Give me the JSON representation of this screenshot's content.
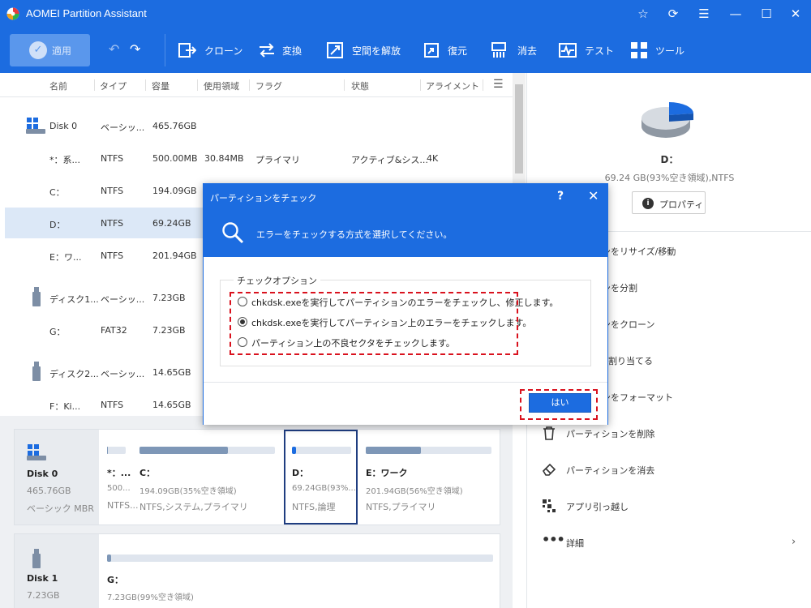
{
  "app": {
    "title": "AOMEI Partition Assistant"
  },
  "toolbar": {
    "apply": "適用",
    "tools": [
      {
        "label": "クローン",
        "icon": "clone-icon"
      },
      {
        "label": "変換",
        "icon": "convert-icon"
      },
      {
        "label": "空間を解放",
        "icon": "free-space-icon"
      },
      {
        "label": "復元",
        "icon": "recover-icon"
      },
      {
        "label": "消去",
        "icon": "wipe-icon"
      },
      {
        "label": "テスト",
        "icon": "test-icon"
      },
      {
        "label": "ツール",
        "icon": "tools-icon"
      }
    ]
  },
  "grid": {
    "columns": [
      "名前",
      "タイプ",
      "容量",
      "使用領域",
      "フラグ",
      "状態",
      "アライメント"
    ],
    "rows": [
      {
        "name": "Disk 0",
        "type": "ベーシッ...",
        "capacity": "465.76GB",
        "used": "",
        "flag": "",
        "status": "",
        "align": ""
      },
      {
        "name": "*：系...",
        "type": "NTFS",
        "capacity": "500.00MB",
        "used": "30.84MB",
        "flag": "プライマリ",
        "status": "アクティブ&シス...",
        "align": "4K"
      },
      {
        "name": "C：",
        "type": "NTFS",
        "capacity": "194.09GB",
        "used": "",
        "flag": "",
        "status": "",
        "align": ""
      },
      {
        "name": "D：",
        "type": "NTFS",
        "capacity": "69.24GB",
        "used": "",
        "flag": "",
        "status": "",
        "align": ""
      },
      {
        "name": "E：ワ...",
        "type": "NTFS",
        "capacity": "201.94GB",
        "used": "",
        "flag": "",
        "status": "",
        "align": ""
      },
      {
        "name": "ディスク1...",
        "type": "ベーシッ...",
        "capacity": "7.23GB",
        "used": "",
        "flag": "",
        "status": "",
        "align": ""
      },
      {
        "name": "G：",
        "type": "FAT32",
        "capacity": "7.23GB",
        "used": "",
        "flag": "",
        "status": "",
        "align": ""
      },
      {
        "name": "ディスク2...",
        "type": "ベーシッ...",
        "capacity": "14.65GB",
        "used": "",
        "flag": "",
        "status": "",
        "align": ""
      },
      {
        "name": "F：Ki...",
        "type": "NTFS",
        "capacity": "14.65GB",
        "used": "",
        "flag": "",
        "status": "",
        "align": ""
      }
    ]
  },
  "diskmap": {
    "disk0": {
      "name": "Disk 0",
      "size": "465.76GB",
      "type": "ベーシック MBR",
      "partitions": [
        {
          "name": "*：...",
          "size": "500...",
          "fs": "NTFS...",
          "used_fraction": 0.06
        },
        {
          "name": "C：",
          "size": "194.09GB(35%空き領域)",
          "fs": "NTFS,システム,プライマリ",
          "used_fraction": 0.65
        },
        {
          "name": "D：",
          "size": "69.24GB(93%...",
          "fs": "NTFS,論理",
          "used_fraction": 0.07
        },
        {
          "name": "E：ワーク",
          "size": "201.94GB(56%空き領域)",
          "fs": "NTFS,プライマリ",
          "used_fraction": 0.44
        }
      ]
    },
    "disk1": {
      "name": "Disk 1",
      "size": "7.23GB",
      "partition": {
        "name": "G：",
        "size": "7.23GB(99%空き領域)",
        "used_fraction": 0.01
      }
    }
  },
  "right": {
    "drive": "D：",
    "info": "69.24 GB(93%空き領域),NTFS",
    "properties": "プロパティ",
    "pie_free_fraction": 0.93,
    "ops": [
      {
        "label": "ンをリサイズ/移動",
        "icon": "resize-icon"
      },
      {
        "label": "ンを分割",
        "icon": "split-icon"
      },
      {
        "label": "ンをクローン",
        "icon": "clone-partition-icon"
      },
      {
        "label": "割り当てる",
        "icon": "allocate-icon"
      },
      {
        "label": "ンをフォーマット",
        "icon": "format-icon"
      },
      {
        "label": "パーティションを削除",
        "icon": "trash-icon"
      },
      {
        "label": "パーティションを消去",
        "icon": "eraser-icon"
      },
      {
        "label": "アプリ引っ越し",
        "icon": "app-move-icon"
      },
      {
        "label": "詳細",
        "icon": "more-icon"
      }
    ]
  },
  "dialog": {
    "title": "パーティションをチェック",
    "help": "?",
    "message": "エラーをチェックする方式を選択してください。",
    "group": "チェックオプション",
    "options": [
      {
        "label": "chkdsk.exeを実行してパーティションのエラーをチェックし、修正します。",
        "selected": false
      },
      {
        "label": "chkdsk.exeを実行してパーティション上のエラーをチェックします。",
        "selected": true
      },
      {
        "label": "パーティション上の不良セクタをチェックします。",
        "selected": false
      }
    ],
    "ok": "はい"
  }
}
